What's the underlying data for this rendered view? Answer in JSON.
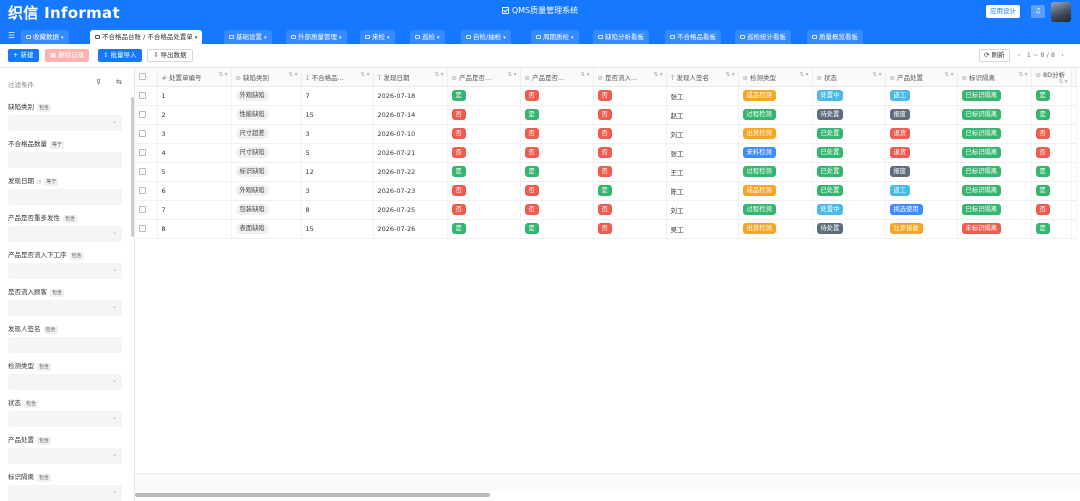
{
  "header": {
    "logo": "织信 Informat",
    "title": "QMS质量管理系统",
    "app_settings": "应用设计",
    "bell_icon": "bell-icon",
    "accent": "#1677ff"
  },
  "tabs": [
    {
      "label": "收藏数据",
      "active": false,
      "has_caret": true
    },
    {
      "label": "不合格品台账 / 不合格品处置单",
      "active": true,
      "has_caret": true
    },
    {
      "label": "基础设置",
      "active": false,
      "has_caret": true
    },
    {
      "label": "外部质量管理",
      "active": false,
      "has_caret": true
    },
    {
      "label": "来检",
      "active": false,
      "has_caret": true
    },
    {
      "label": "巡检",
      "active": false,
      "has_caret": true
    },
    {
      "label": "自检/抽检",
      "active": false,
      "has_caret": true
    },
    {
      "label": "周期质检",
      "active": false,
      "has_caret": true
    },
    {
      "label": "缺陷分析看板",
      "active": false,
      "has_caret": false
    },
    {
      "label": "不合格品看板",
      "active": false,
      "has_caret": false
    },
    {
      "label": "巡检统计看板",
      "active": false,
      "has_caret": false
    },
    {
      "label": "质量概览看板",
      "active": false,
      "has_caret": false
    }
  ],
  "toolbar": {
    "new": "+ 新建",
    "delete": "删除记录",
    "import": "批量导入",
    "export": "导出数据",
    "refresh": "刷新",
    "pager_prev": "‹",
    "pager_range": "1 ~ 8 / 8",
    "pager_next": "›"
  },
  "filter": {
    "heading": "过滤条件",
    "items": [
      {
        "label": "缺陷类别",
        "mode": "包含",
        "type": "select"
      },
      {
        "label": "不合格品数量",
        "mode": "等于",
        "type": "text"
      },
      {
        "label": "发现日期",
        "mode": "等于",
        "type": "text",
        "has_clock": true
      },
      {
        "label": "产品是否重多发性",
        "mode": "包含",
        "type": "select"
      },
      {
        "label": "产品是否流入下工序",
        "mode": "包含",
        "type": "select"
      },
      {
        "label": "是否流入顾客",
        "mode": "包含",
        "type": "select"
      },
      {
        "label": "发现人签名",
        "mode": "包含",
        "type": "text"
      },
      {
        "label": "检测类型",
        "mode": "包含",
        "type": "select"
      },
      {
        "label": "状态",
        "mode": "包含",
        "type": "select"
      },
      {
        "label": "产品处置",
        "mode": "包含",
        "type": "select"
      },
      {
        "label": "标识隔离",
        "mode": "包含",
        "type": "select"
      }
    ]
  },
  "table": {
    "columns": [
      {
        "label": "处置单编号",
        "icon": "#"
      },
      {
        "label": "缺陷类别",
        "icon": "⊘"
      },
      {
        "label": "不合格品...",
        "icon": "1"
      },
      {
        "label": "发现日期",
        "icon": "T"
      },
      {
        "label": "产品是否...",
        "icon": "⊘"
      },
      {
        "label": "产品是否...",
        "icon": "⊘"
      },
      {
        "label": "是否流入...",
        "icon": "⊘"
      },
      {
        "label": "发现人签名",
        "icon": "T"
      },
      {
        "label": "检测类型",
        "icon": "⊘"
      },
      {
        "label": "状态",
        "icon": "⊘"
      },
      {
        "label": "产品处置",
        "icon": "⊘"
      },
      {
        "label": "标识隔离",
        "icon": "⊘"
      },
      {
        "label": "8D分析",
        "icon": "⊘"
      }
    ],
    "rows": [
      {
        "id": "1",
        "defect": "外观缺陷",
        "qty": "7",
        "date": "2026-07-18",
        "a": "是",
        "b": "否",
        "c": "否",
        "person": "张工",
        "inspect": "成品检测",
        "status": "处置中",
        "disposal": "返工",
        "isolate": "已标识隔离",
        "d8": "是"
      },
      {
        "id": "2",
        "defect": "性能缺陷",
        "qty": "15",
        "date": "2026-07-14",
        "a": "否",
        "b": "是",
        "c": "否",
        "person": "赵工",
        "inspect": "过程检测",
        "status": "待处置",
        "disposal": "报废",
        "isolate": "已标识隔离",
        "d8": "是"
      },
      {
        "id": "3",
        "defect": "尺寸超差",
        "qty": "3",
        "date": "2026-07-10",
        "a": "否",
        "b": "否",
        "c": "否",
        "person": "刘工",
        "inspect": "出货检测",
        "status": "已处置",
        "disposal": "退货",
        "isolate": "已标识隔离",
        "d8": "否"
      },
      {
        "id": "4",
        "defect": "尺寸缺陷",
        "qty": "5",
        "date": "2026-07-21",
        "a": "否",
        "b": "否",
        "c": "否",
        "person": "张工",
        "inspect": "来料检测",
        "status": "已处置",
        "disposal": "退货",
        "isolate": "已标识隔离",
        "d8": "否"
      },
      {
        "id": "5",
        "defect": "标识缺陷",
        "qty": "12",
        "date": "2026-07-22",
        "a": "是",
        "b": "是",
        "c": "否",
        "person": "王工",
        "inspect": "过程检测",
        "status": "已处置",
        "disposal": "报废",
        "isolate": "已标识隔离",
        "d8": "是"
      },
      {
        "id": "6",
        "defect": "外观缺陷",
        "qty": "3",
        "date": "2026-07-23",
        "a": "否",
        "b": "否",
        "c": "是",
        "person": "陈工",
        "inspect": "成品检测",
        "status": "已处置",
        "disposal": "返工",
        "isolate": "已标识隔离",
        "d8": "是"
      },
      {
        "id": "7",
        "defect": "包装缺陷",
        "qty": "8",
        "date": "2026-07-25",
        "a": "否",
        "b": "否",
        "c": "否",
        "person": "刘工",
        "inspect": "过程检测",
        "status": "处置中",
        "disposal": "挑选使用",
        "isolate": "已标识隔离",
        "d8": "否"
      },
      {
        "id": "8",
        "defect": "表面缺陷",
        "qty": "15",
        "date": "2026-07-26",
        "a": "是",
        "b": "是",
        "c": "否",
        "person": "吴工",
        "inspect": "出货检测",
        "status": "待处置",
        "disposal": "让步接收",
        "isolate": "未标识隔离",
        "d8": "是"
      }
    ]
  },
  "colors": {
    "yes": "#35b66f",
    "no": "#ef5b4f",
    "status": {
      "处置中": "#48b9e8",
      "待处置": "#5d6d7e",
      "已处置": "#35b66f"
    },
    "inspect": {
      "成品检测": "#f5a623",
      "过程检测": "#35b66f",
      "出货检测": "#f5a623",
      "来料检测": "#3d8bff"
    },
    "disposal": {
      "返工": "#48b9e8",
      "报废": "#5d6d7e",
      "退货": "#ef5b4f",
      "挑选使用": "#3d8bff",
      "让步接收": "#f5a623"
    },
    "isolate": {
      "已标识隔离": "#35b66f",
      "未标识隔离": "#ef5b4f"
    }
  }
}
